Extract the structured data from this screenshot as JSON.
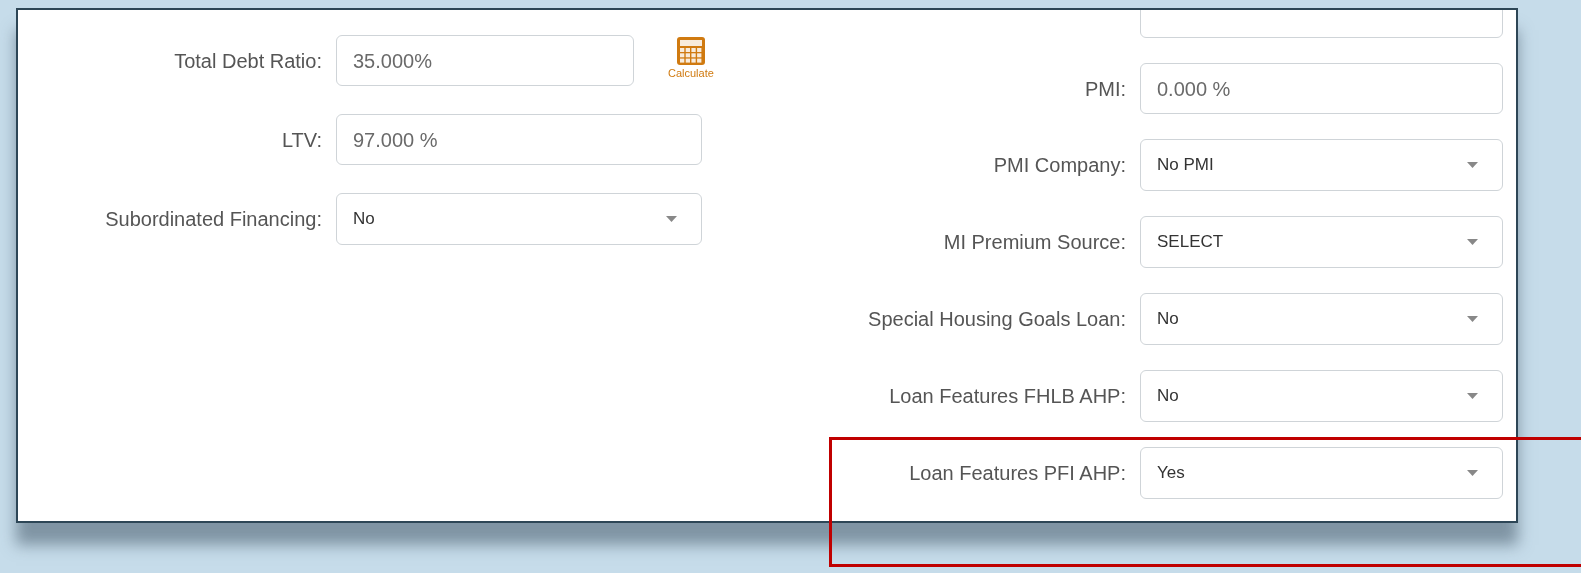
{
  "left_fields": [
    {
      "label": "Total Debt Ratio:",
      "kind": "text",
      "value": "35.000%",
      "action": "Calculate"
    },
    {
      "label": "LTV:",
      "kind": "text",
      "value": "97.000 %"
    },
    {
      "label": "Subordinated Financing:",
      "kind": "select",
      "value": "No"
    }
  ],
  "right_fields": [
    {
      "label": "PMI:",
      "kind": "text",
      "value": "0.000 %"
    },
    {
      "label": "PMI Company:",
      "kind": "select",
      "value": "No PMI"
    },
    {
      "label": "MI Premium Source:",
      "kind": "select",
      "value": "SELECT"
    },
    {
      "label": "Special Housing Goals Loan:",
      "kind": "select",
      "value": "No"
    },
    {
      "label": "Loan Features FHLB AHP:",
      "kind": "select",
      "value": "No"
    },
    {
      "label": "Loan Features PFI AHP:",
      "kind": "select",
      "value": "Yes"
    }
  ]
}
